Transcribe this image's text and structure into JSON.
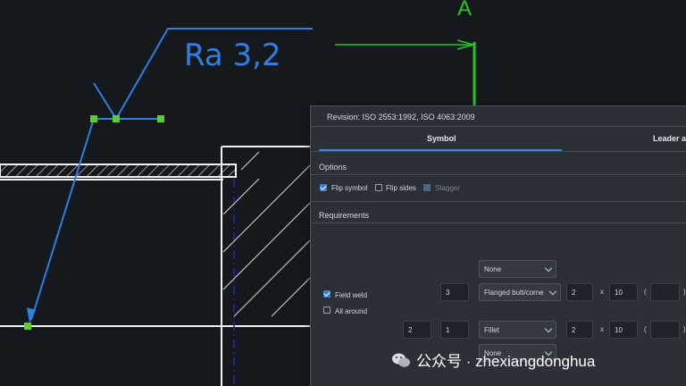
{
  "canvas": {
    "section_label": "A",
    "roughness_label": "Ra 3,2"
  },
  "panel": {
    "revision": "Revision: ISO 2553:1992, ISO 4063:2009",
    "tabs": [
      "Symbol",
      "Leader a"
    ],
    "options": {
      "title": "Options",
      "flip_symbol": "Flip symbol",
      "flip_sides": "Flip sides",
      "stagger": "Stagger"
    },
    "requirements": {
      "title": "Requirements",
      "field_weld": "Field weld",
      "all_around": "All around"
    },
    "weld": {
      "top_dropdown": "None",
      "row1": {
        "count": "3",
        "type": "Flanged butt/corne",
        "size": "2",
        "x": "x",
        "length": "10",
        "paren": "(",
        "pitch": "",
        "paren_close": ")"
      },
      "row2": {
        "a": "2",
        "b": "1",
        "type": "Fillet",
        "size": "2",
        "x": "x",
        "length": "10",
        "paren": "(",
        "pitch": "",
        "paren_close": ")"
      },
      "bottom_dropdown": "None"
    }
  },
  "watermark": {
    "text": "公众号 · zhexiangdonghua",
    "icon": "wechat-icon"
  },
  "colors": {
    "background": "#15181d",
    "blue_annotation": "#2f7fe0",
    "green_grip": "#5ccc2e",
    "section_arrow": "#1ec81e",
    "accent": "#3d7fd9"
  }
}
